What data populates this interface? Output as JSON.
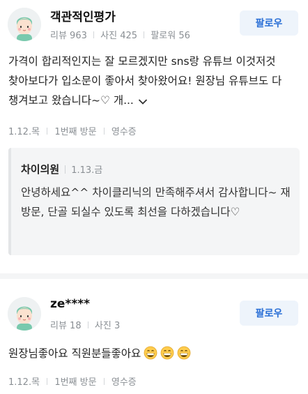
{
  "reviews": [
    {
      "reviewer_name": "객관적인평가",
      "stats": {
        "reviews": "리뷰 963",
        "photos": "사진 425",
        "followers": "팔로워 56"
      },
      "follow_label": "팔로우",
      "text": "가격이 합리적인지는 잘 모르겠지만 sns랑 유튜브 이것저것 찾아보다가 입소문이 좋아서 찾아왔어요! 원장님 유튜브도 다 챙겨보고 왔습니다~♡ 개...",
      "more_icon": "chevron-down-icon",
      "meta": {
        "date": "1.12.",
        "weekday": "목",
        "visit": "1번째 방문",
        "receipt": "영수증"
      },
      "owner_reply": {
        "owner_name": "차이의원",
        "date": "1.13.금",
        "text": "안녕하세요^^ 차이클리닉의 만족해주셔서 감사합니다~ 재방문, 단골 되실수 있도록 최선을 다하겠습니다♡"
      }
    },
    {
      "reviewer_name": "ze****",
      "stats": {
        "reviews": "리뷰 18",
        "photos": "사진 3"
      },
      "follow_label": "팔로우",
      "text": "원장님좋아요 직원분들좋아요",
      "emojis": [
        "grinning-face-icon",
        "grinning-face-icon",
        "grinning-face-icon"
      ],
      "meta": {
        "date": "1.12.",
        "weekday": "목",
        "visit": "1번째 방문",
        "receipt": "영수증"
      }
    }
  ]
}
